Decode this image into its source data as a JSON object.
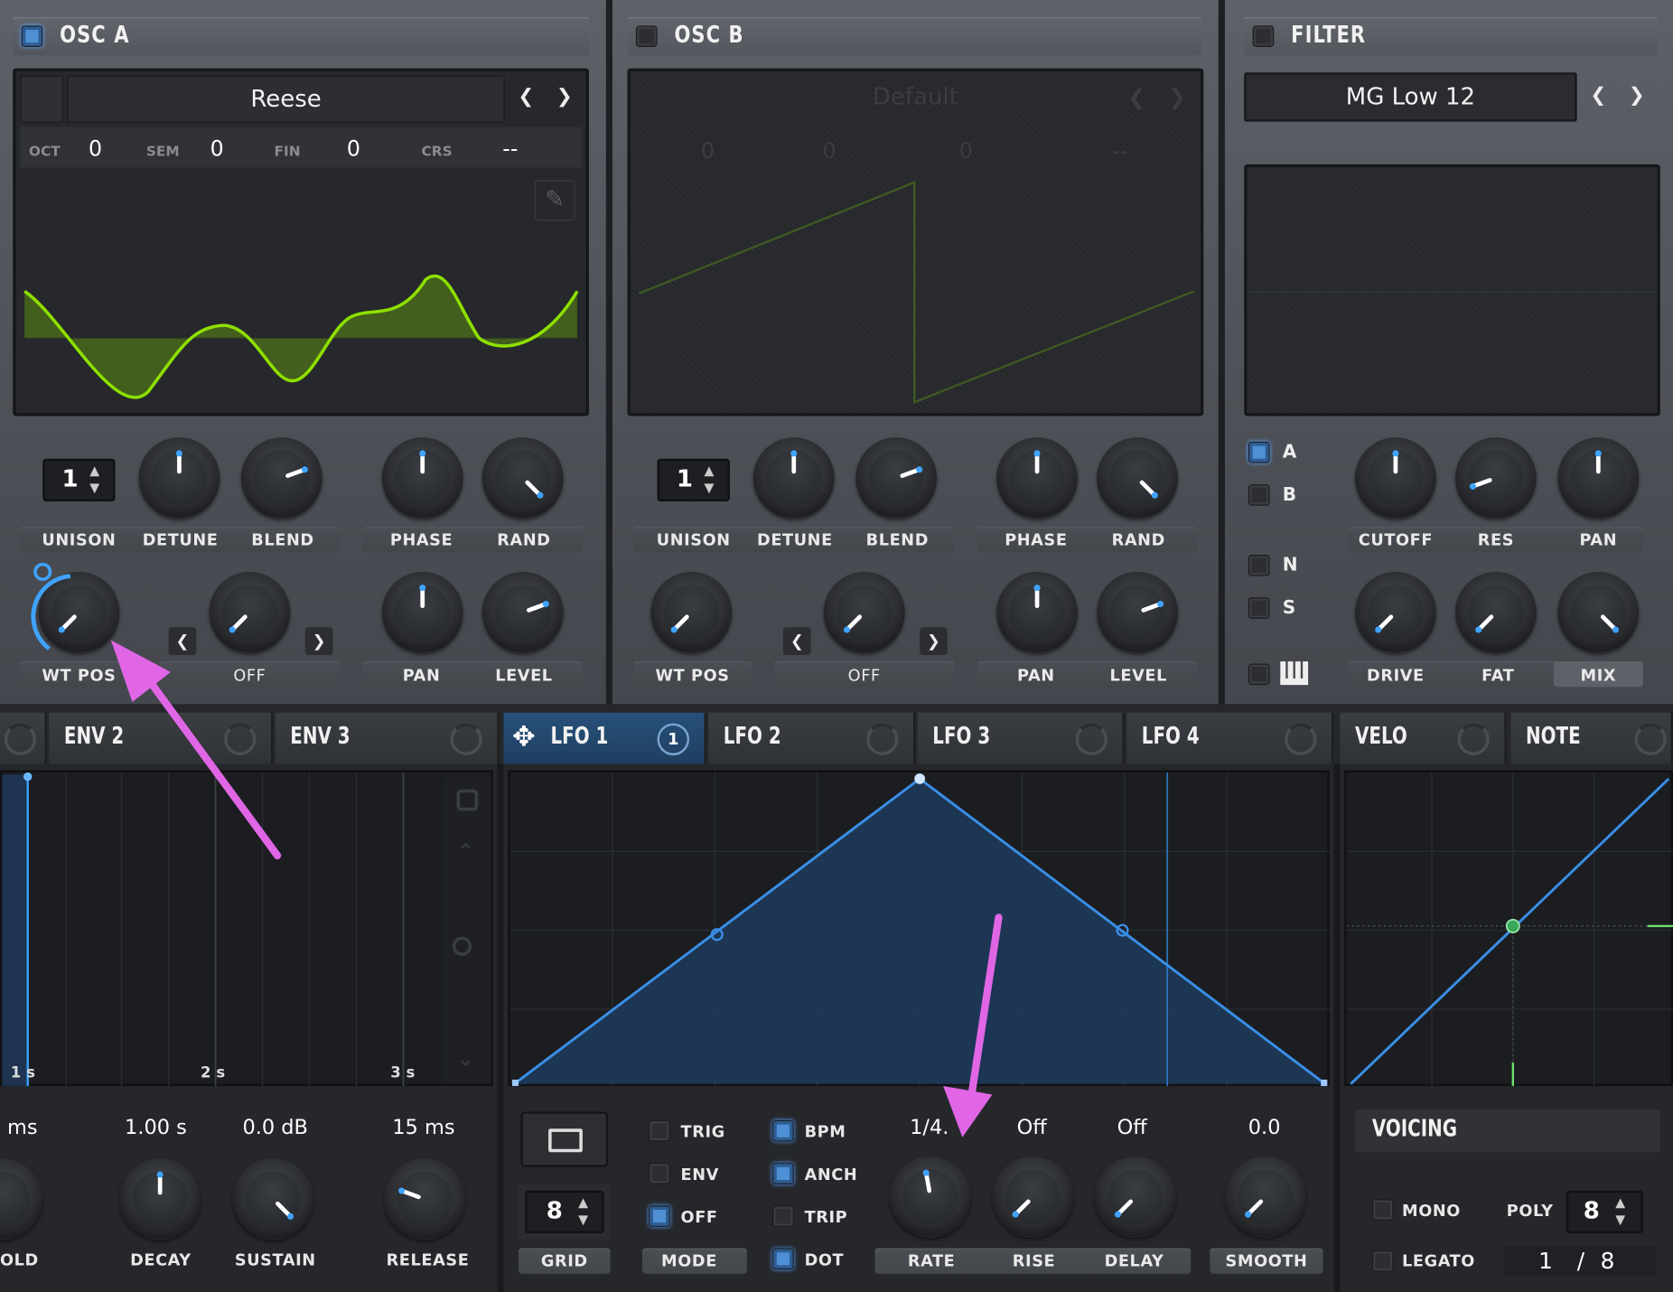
{
  "osc_a": {
    "title": "OSC A",
    "enabled": true,
    "wavetable": "Reese",
    "oct_label": "OCT",
    "oct": "0",
    "sem_label": "SEM",
    "sem": "0",
    "fin_label": "FIN",
    "fin": "0",
    "crs_label": "CRS",
    "crs": "--",
    "unison": "1",
    "knobs": [
      "UNISON",
      "DETUNE",
      "BLEND",
      "PHASE",
      "RAND",
      "WT POS",
      "OFF",
      "PAN",
      "LEVEL"
    ]
  },
  "osc_b": {
    "title": "OSC B",
    "enabled": false,
    "wavetable": "Default",
    "oct": "0",
    "sem": "0",
    "fin": "0",
    "crs": "--",
    "unison": "1",
    "knobs": [
      "UNISON",
      "DETUNE",
      "BLEND",
      "PHASE",
      "RAND",
      "WT POS",
      "OFF",
      "PAN",
      "LEVEL"
    ]
  },
  "filter": {
    "title": "FILTER",
    "enabled": false,
    "type": "MG Low 12",
    "routes": [
      "A",
      "B",
      "N",
      "S"
    ],
    "route_a_on": true,
    "knobs": [
      "CUTOFF",
      "RES",
      "PAN",
      "DRIVE",
      "FAT",
      "MIX"
    ]
  },
  "mod_tabs": {
    "env2": "ENV 2",
    "env3": "ENV 3",
    "lfo1": "LFO 1",
    "lfo1_count": "1",
    "lfo2": "LFO 2",
    "lfo3": "LFO 3",
    "lfo4": "LFO 4",
    "velo": "VELO",
    "note": "NOTE"
  },
  "env": {
    "time_marks": [
      "1 s",
      "2 s",
      "3 s"
    ],
    "values": [
      "ms",
      "1.00 s",
      "0.0 dB",
      "15 ms"
    ],
    "labels": [
      "OLD",
      "DECAY",
      "SUSTAIN",
      "RELEASE"
    ]
  },
  "lfo": {
    "grid": "8",
    "grid_label": "GRID",
    "mode_label": "MODE",
    "opts_left": [
      "TRIG",
      "ENV",
      "OFF"
    ],
    "opts_right": [
      "BPM",
      "ANCH",
      "TRIP",
      "DOT"
    ],
    "rate_value": "1/4.",
    "rise_value": "Off",
    "delay_value": "Off",
    "smooth_value": "0.0",
    "knob_labels": [
      "RATE",
      "RISE",
      "DELAY",
      "SMOOTH"
    ]
  },
  "voicing": {
    "title": "VOICING",
    "mono": "MONO",
    "legato": "LEGATO",
    "poly_label": "POLY",
    "poly": "8",
    "voices_a": "1",
    "voices_sep": "/",
    "voices_b": "8"
  },
  "colors": {
    "accent": "#3fa3ff",
    "wave": "#8ee000",
    "annotation": "#e066e6"
  }
}
